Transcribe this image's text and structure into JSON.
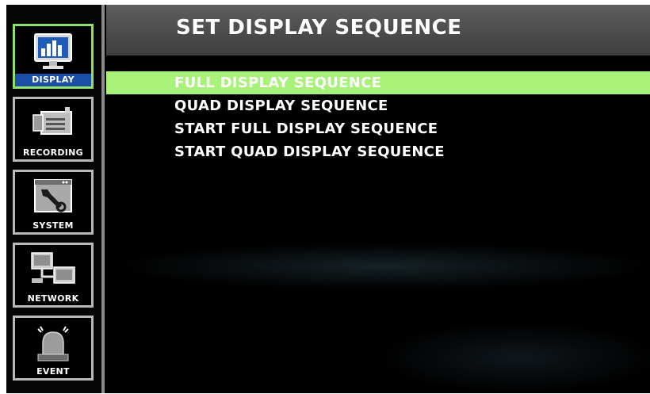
{
  "sidebar": {
    "items": [
      {
        "label": "DISPLAY",
        "icon": "monitor-chart-icon",
        "active": true
      },
      {
        "label": "RECORDING",
        "icon": "video-camera-icon",
        "active": false
      },
      {
        "label": "SYSTEM",
        "icon": "settings-wrench-icon",
        "active": false
      },
      {
        "label": "NETWORK",
        "icon": "network-computers-icon",
        "active": false
      },
      {
        "label": "EVENT",
        "icon": "alarm-siren-icon",
        "active": false
      }
    ]
  },
  "header": {
    "title": "SET DISPLAY SEQUENCE"
  },
  "menu": {
    "items": [
      {
        "label": "FULL DISPLAY SEQUENCE",
        "selected": true
      },
      {
        "label": "QUAD DISPLAY SEQUENCE",
        "selected": false
      },
      {
        "label": "START FULL DISPLAY SEQUENCE",
        "selected": false
      },
      {
        "label": "START QUAD DISPLAY SEQUENCE",
        "selected": false
      }
    ]
  },
  "colors": {
    "selected_highlight": "#a9f27a",
    "active_border": "#8ee26a",
    "active_label_bg": "#1b4ea6",
    "header_bg": "#4c4c4c"
  }
}
